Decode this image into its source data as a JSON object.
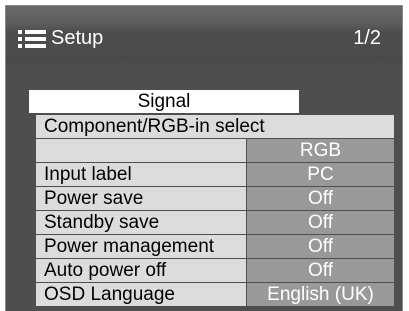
{
  "header": {
    "title": "Setup",
    "page": "1/2"
  },
  "signal_button": {
    "label": "Signal"
  },
  "component_select": {
    "label": "Component/RGB-in select",
    "value": "RGB"
  },
  "rows": [
    {
      "label": "Input label",
      "value": "PC"
    },
    {
      "label": "Power save",
      "value": "Off"
    },
    {
      "label": "Standby save",
      "value": "Off"
    },
    {
      "label": "Power management",
      "value": "Off"
    },
    {
      "label": "Auto power off",
      "value": "Off"
    },
    {
      "label": "OSD Language",
      "value": "English (UK)"
    }
  ],
  "colors": {
    "background": "#4e4e4e",
    "label_bg": "#dcdcdc",
    "value_bg": "#999999"
  },
  "icons": {
    "menu": "menu-list-icon"
  }
}
